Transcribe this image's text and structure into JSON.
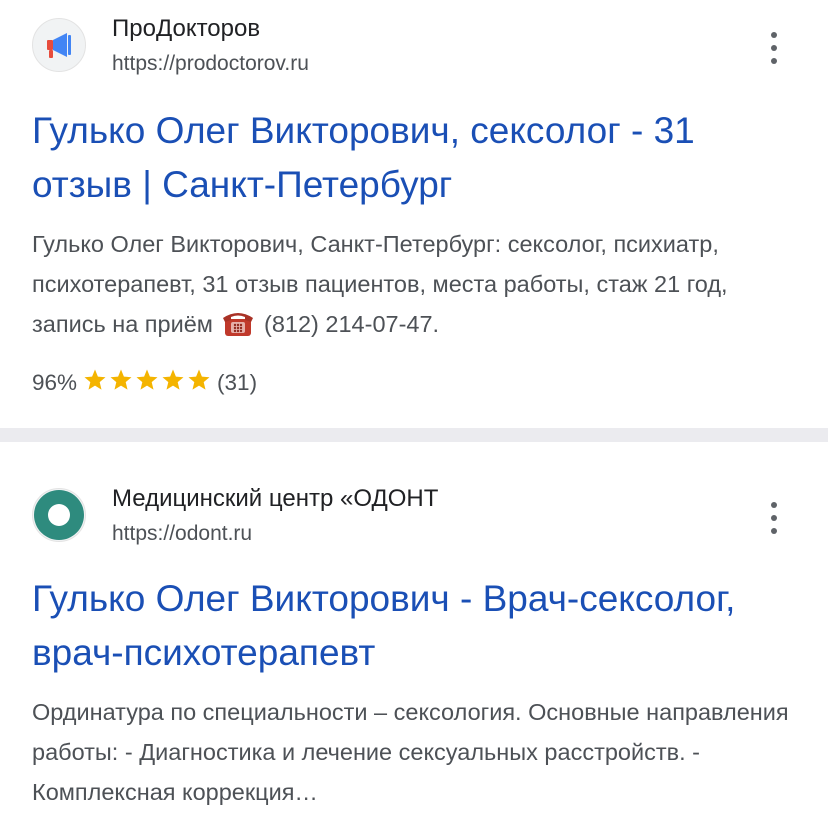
{
  "results": [
    {
      "site_name": "ПроДокторов",
      "url": "https://prodoctorov.ru",
      "favicon": "megaphone-icon",
      "title": "Гулько Олег Викторович, сексолог - 31 отзыв | Санкт-Петербург",
      "snippet_before_icon": "Гулько Олег Викторович, Санкт-Петербург: сексолог, психиатр, психотерапевт, 31 отзыв пациентов, места работы, стаж 21 год, запись на приём",
      "snippet_icon": "telephone-icon",
      "snippet_after_icon": "(812) 214-07-47.",
      "rating": {
        "percent": "96%",
        "stars": 5,
        "count": "(31)"
      }
    },
    {
      "site_name": "Медицинский центр «ОДОНТ",
      "url": "https://odont.ru",
      "favicon": "ring-logo-icon",
      "title": "Гулько Олег Викторович - Врач-сексолог, врач-психотерапевт",
      "snippet": "Ординатура по специальности – сексология. Основные направления работы: - Диагностика и лечение сексуальных расстройств. - Комплексная коррекция…"
    }
  ],
  "colors": {
    "title_link": "#1a4fb5",
    "snippet_text": "#4d5156",
    "star": "#f4b400",
    "separator": "#ebebef",
    "odont_logo": "#2e8b7e",
    "megaphone": "#4285f4"
  }
}
